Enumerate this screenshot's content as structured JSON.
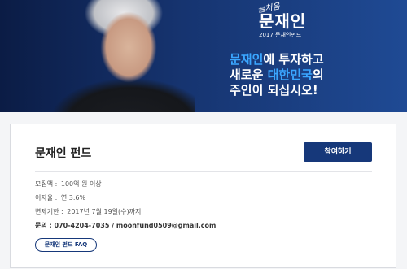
{
  "banner": {
    "signature": "늘처음",
    "brand": "문재인",
    "subbrand": "2017 문재인펀드",
    "slogan": {
      "line1_highlight": "문재인",
      "line1_rest": "에 투자하고",
      "line2_prefix": "새로운 ",
      "line2_highlight": "대한민국",
      "line2_suffix": "의",
      "line3": "주인이 되십시오!"
    }
  },
  "fund": {
    "title": "문재인 펀드",
    "join_label": "참여하기",
    "target_label": "모집액",
    "target_value": "100억 원 이상",
    "rate_label": "이자율",
    "rate_value": "연 3.6%",
    "repay_label": "변제기한",
    "repay_value": "2017년 7월 19일(수)까지",
    "contact_label": "문의",
    "phone": "070-4204-7035",
    "separator": "/",
    "email": "moonfund0509@gmail.com",
    "faq_label": "문재인 펀드 FAQ"
  },
  "colors": {
    "banner_bg": "#163470",
    "accent": "#16387a",
    "highlight": "#3aa6ff"
  }
}
